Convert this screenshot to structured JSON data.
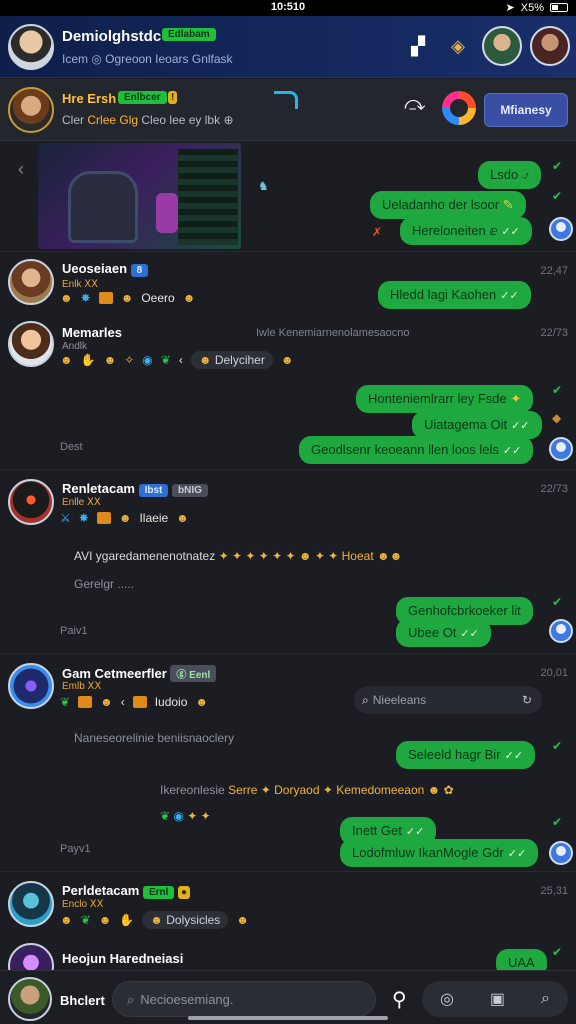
{
  "status": {
    "time": "10:510",
    "battery": "X5%"
  },
  "header": {
    "title": "Demiolghstdc",
    "badge": "Edlabam",
    "subtitle": "Icem  ◎  Ogreoon Ieoars Gnlfask",
    "icons": [
      "windows-icon",
      "ticket-icon",
      "friend-avatar",
      "friend-avatar"
    ]
  },
  "group": {
    "name": "Hre Ersh",
    "badge": "Enlbcer",
    "badge2": "!",
    "sub_a": "Cler",
    "sub_b": "Crlee Glg",
    "sub_c": "Cleo lee  ey lbk",
    "button": "Mfianesy"
  },
  "messages": {
    "m1": "Lsdo ⍻",
    "m2": "Ueladanho der lsoor",
    "m3": "Hereloneiten ⅇ",
    "m3_icon": "✗",
    "m4": "Hledd lagi Kaohen",
    "m5": "Honteniemlrarr ley Fsde",
    "m6": "Uiatagema Oit",
    "m7": "Geodlsenr keoeann llen loos lels",
    "m8": "Genhofcbrkoeker lit",
    "m9": "Ubee Ot",
    "m10": "Seleeld hagr Bir",
    "m11": "Inett Get",
    "m12": "Lodofmluw IkanMogle Gdr",
    "m13": "UAA"
  },
  "senders": {
    "s1": {
      "name": "Ueoseiaen",
      "badge": "8",
      "role": "Enlk ⅩⅩ",
      "chip": "Oeero",
      "time": "22,47"
    },
    "s2": {
      "name": "Memarles",
      "role": "Andlk",
      "chip": "Delyciher",
      "time": "22/73",
      "system": "Iwle Kenemiarnenolamesaocno"
    },
    "s3": {
      "name": "Renletacam",
      "badge1": "Ibst",
      "badge2": "bNIG",
      "role": "Enlle ⅩⅩ",
      "chip": "Ilaeie",
      "time": "22/73"
    },
    "s4": {
      "name": "Gam Cetmeerfler",
      "badge": "ⓖ Eenl",
      "role": "Emlb ⅩⅩ",
      "chip": "Iudoio",
      "time": "20,01"
    },
    "s5": {
      "name": "Perldetacam",
      "badge": "Ernl",
      "role": "Enclo ⅩⅩ",
      "chip": "Dolysicles",
      "time": "25,31"
    },
    "s6": {
      "name": "Heojun Haredneiasi"
    }
  },
  "system": {
    "t1": "Dest",
    "t2": "AVI ygaredamenenotnatez",
    "t2_end": "Hoeat",
    "t3": "Gerelgr .....",
    "t4": "Paiv1",
    "t5": "Naneseorelinie beniisnaoclery",
    "t6": "Ikereonlesie",
    "t6_b": "Serre",
    "t6_c": "Doryaod",
    "t6_d": "Kemedomeeaon",
    "t7": "Payv1",
    "search": "Nieeleans"
  },
  "composer": {
    "user": "Bhclert",
    "placeholder": "Necioesemiang.",
    "tools": [
      "gamepad-icon",
      "image-icon",
      "note-icon"
    ]
  }
}
